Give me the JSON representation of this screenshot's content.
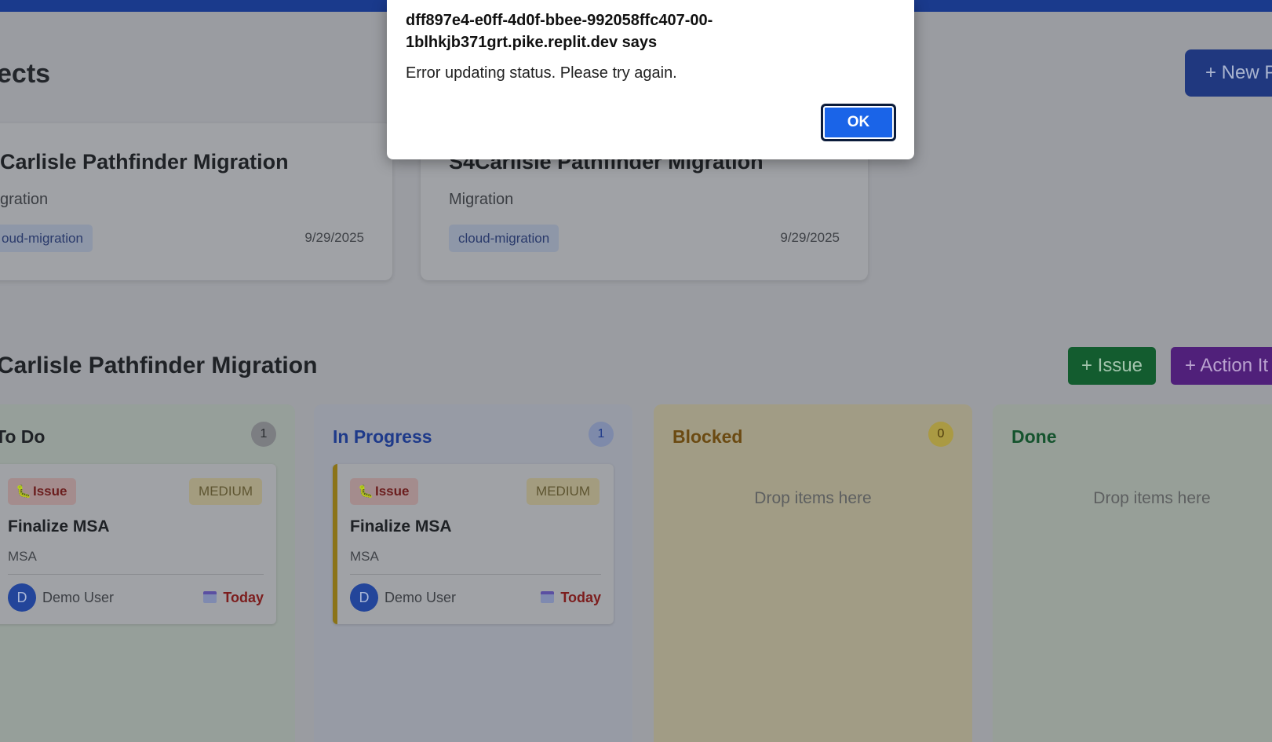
{
  "projects": {
    "title": "ects",
    "new_button": "+ New P",
    "cards": [
      {
        "title": "Carlisle Pathfinder Migration",
        "type": "gration",
        "tag": "oud-migration",
        "date": "9/29/2025"
      },
      {
        "title": "S4Carlisle Pathfinder Migration",
        "type": "Migration",
        "tag": "cloud-migration",
        "date": "9/29/2025"
      }
    ]
  },
  "board": {
    "title": "Carlisle Pathfinder Migration",
    "issue_button": "+ Issue",
    "action_button": "+ Action It",
    "columns": [
      {
        "name": "To Do",
        "count": "1",
        "color": "#1f2226",
        "item": {
          "type": "Issue",
          "priority": "MEDIUM",
          "title": "Finalize MSA",
          "desc": "MSA",
          "avatar": "D",
          "assignee": "Demo User",
          "due": "Today"
        }
      },
      {
        "name": "In Progress",
        "count": "1",
        "color": "#1e3a8a",
        "item": {
          "type": "Issue",
          "priority": "MEDIUM",
          "title": "Finalize MSA",
          "desc": "MSA",
          "avatar": "D",
          "assignee": "Demo User",
          "due": "Today"
        }
      },
      {
        "name": "Blocked",
        "count": "0",
        "color": "#6b4a12",
        "empty": "Drop items here"
      },
      {
        "name": "Done",
        "color": "#15532e",
        "empty": "Drop items here"
      }
    ]
  },
  "dialog": {
    "origin": "dff897e4-e0ff-4d0f-bbee-992058ffc407-00-1blhkjb371grt.pike.replit.dev says",
    "message": "Error updating status. Please try again.",
    "ok": "OK"
  }
}
